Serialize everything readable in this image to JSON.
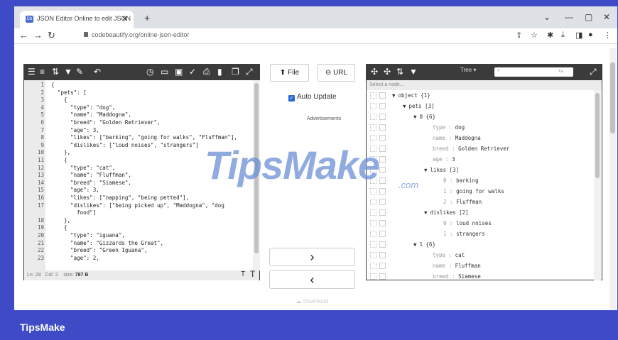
{
  "browser": {
    "tab_title": "JSON Editor Online to edit JSON",
    "url": "codebeautify.org/online-json-editor"
  },
  "left_editor": {
    "lines": [
      {
        "n": "1",
        "t": "{"
      },
      {
        "n": "2",
        "t": "  \"pets\": ["
      },
      {
        "n": "3",
        "t": "    {"
      },
      {
        "n": "4",
        "t": "      \"type\": \"dog\","
      },
      {
        "n": "5",
        "t": "      \"name\": \"Maddogna\","
      },
      {
        "n": "6",
        "t": "      \"breed\": \"Golden Retriever\","
      },
      {
        "n": "7",
        "t": "      \"age\": 3,"
      },
      {
        "n": "8",
        "t": "      \"likes\": [\"barking\", \"going for walks\", \"Fluffman\"],"
      },
      {
        "n": "9",
        "t": "      \"dislikes\": [\"loud noises\", \"strangers\"]"
      },
      {
        "n": "10",
        "t": "    },"
      },
      {
        "n": "11",
        "t": "    {"
      },
      {
        "n": "12",
        "t": "      \"type\": \"cat\","
      },
      {
        "n": "13",
        "t": "      \"name\": \"Fluffman\","
      },
      {
        "n": "14",
        "t": "      \"breed\": \"Siamese\","
      },
      {
        "n": "15",
        "t": "      \"age\": 3,"
      },
      {
        "n": "16",
        "t": "      \"likes\": [\"napping\", \"being petted\"],"
      },
      {
        "n": "17",
        "t": "      \"dislikes\": [\"being picked up\", \"Maddogna\", \"dog"
      },
      {
        "n": "",
        "t": "        food\"]"
      },
      {
        "n": "18",
        "t": "    },"
      },
      {
        "n": "19",
        "t": "    {"
      },
      {
        "n": "20",
        "t": "      \"type\": \"iguana\","
      },
      {
        "n": "21",
        "t": "      \"name\": \"Gizzards the Great\","
      },
      {
        "n": "22",
        "t": "      \"breed\": \"Green Iguana\","
      },
      {
        "n": "23",
        "t": "      \"age\": 2,"
      }
    ],
    "status": {
      "ln": "Ln: 28",
      "col": "Col: 2",
      "size_label": "size:",
      "size_value": "787 B"
    }
  },
  "middle": {
    "file_label": "File",
    "url_label": "URL",
    "auto_update": "Auto Update",
    "ads": "Advertisements",
    "download": "Download",
    "right_arrow": "›",
    "left_arrow": "‹"
  },
  "right_tree": {
    "mode": "Tree ▾",
    "select_placeholder": "Select a node...",
    "rows": [
      {
        "indent": 0,
        "arrow": "▼",
        "key": "object",
        "val": "{1}"
      },
      {
        "indent": 1,
        "arrow": "▼",
        "key": "pets",
        "val": "[3]"
      },
      {
        "indent": 2,
        "arrow": "▼",
        "key": "0",
        "val": "{6}"
      },
      {
        "indent": 3,
        "arrow": "",
        "key": "type",
        "val": "dog"
      },
      {
        "indent": 3,
        "arrow": "",
        "key": "name",
        "val": "Maddogna"
      },
      {
        "indent": 3,
        "arrow": "",
        "key": "breed",
        "val": "Golden Retriever"
      },
      {
        "indent": 3,
        "arrow": "",
        "key": "age",
        "val": "3"
      },
      {
        "indent": 3,
        "arrow": "▼",
        "key": "likes",
        "val": "[3]"
      },
      {
        "indent": 4,
        "arrow": "",
        "key": "0",
        "val": "barking"
      },
      {
        "indent": 4,
        "arrow": "",
        "key": "1",
        "val": "going for walks"
      },
      {
        "indent": 4,
        "arrow": "",
        "key": "2",
        "val": "Fluffman"
      },
      {
        "indent": 3,
        "arrow": "▼",
        "key": "dislikes",
        "val": "[2]"
      },
      {
        "indent": 4,
        "arrow": "",
        "key": "0",
        "val": "loud noises"
      },
      {
        "indent": 4,
        "arrow": "",
        "key": "1",
        "val": "strangers"
      },
      {
        "indent": 2,
        "arrow": "▼",
        "key": "1",
        "val": "{6}"
      },
      {
        "indent": 3,
        "arrow": "",
        "key": "type",
        "val": "cat"
      },
      {
        "indent": 3,
        "arrow": "",
        "key": "name",
        "val": "Fluffman"
      },
      {
        "indent": 3,
        "arrow": "",
        "key": "breed",
        "val": "Siamese"
      }
    ]
  },
  "watermark": {
    "main": "TipsMake",
    "sub": ".com"
  },
  "footer": {
    "brand": "TipsMake"
  }
}
